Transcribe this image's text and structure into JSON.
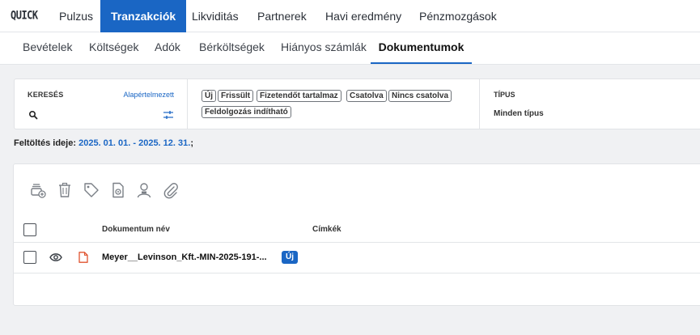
{
  "app": {
    "logo": "QUICK"
  },
  "topnav": {
    "items": [
      {
        "label": "Pulzus",
        "active": false
      },
      {
        "label": "Tranzakciók",
        "active": true
      },
      {
        "label": "Likviditás",
        "active": false
      },
      {
        "label": "Partnerek",
        "active": false
      },
      {
        "label": "Havi eredmény",
        "active": false
      },
      {
        "label": "Pénzmozgások",
        "active": false
      }
    ]
  },
  "subnav": {
    "items": [
      {
        "label": "Bevételek",
        "active": false
      },
      {
        "label": "Költségek",
        "active": false
      },
      {
        "label": "Adók",
        "active": false
      },
      {
        "label": "Bérköltségek",
        "active": false
      },
      {
        "label": "Hiányos számlák",
        "active": false
      },
      {
        "label": "Dokumentumok",
        "active": true
      }
    ]
  },
  "filters": {
    "search": {
      "label": "KERESÉS",
      "default_link": "Alapértelmezett",
      "value": ""
    },
    "tags": [
      "Új",
      "Frissült",
      "Fizetendőt tartalmaz",
      "Csatolva",
      "Nincs csatolva",
      "Feldolgozás indítható"
    ],
    "type": {
      "label": "TÍPUS",
      "value": "Minden típus"
    }
  },
  "upload": {
    "label": "Feltöltés ideje:",
    "range": "2025. 01. 01. - 2025. 12. 31.",
    "suffix": ";"
  },
  "toolbar": {
    "icons": [
      "add-stack-icon",
      "trash-icon",
      "tag-icon",
      "document-settings-icon",
      "assign-user-icon",
      "attach-icon"
    ]
  },
  "table": {
    "headers": {
      "name": "Dokumentum név",
      "tags": "Címkék"
    },
    "rows": [
      {
        "name": "Meyer__Levinson_Kft.-MIN-2025-191-...",
        "badge": "Új",
        "checked": false
      }
    ]
  },
  "colors": {
    "accent": "#1a66c4",
    "pdf_icon": "#e0532f"
  }
}
